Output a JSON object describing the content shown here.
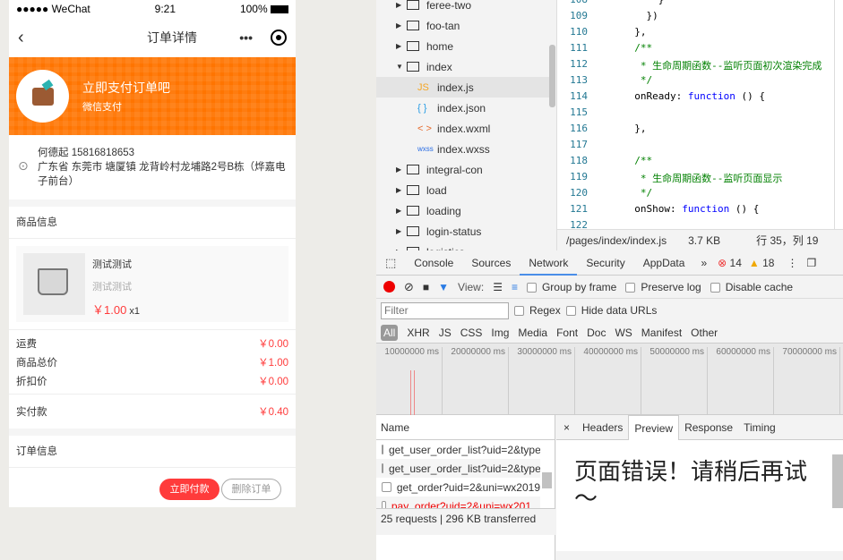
{
  "phone": {
    "status": {
      "carrier": "●●●●● WeChat",
      "time": "9:21",
      "battery": "100%"
    },
    "nav": {
      "title": "订单详情",
      "more": "•••"
    },
    "banner": {
      "title": "立即支付订单吧",
      "subtitle": "微信支付",
      "color": "#ff7400"
    },
    "address": {
      "contact": "何德起 15816818653",
      "line": "广东省 东莞市 塘厦镇 龙背岭村龙埔路2号B栋（烨嘉电子前台）"
    },
    "goods_header": "商品信息",
    "goods": {
      "name": "测试测试",
      "spec": "测试测试",
      "price": "￥1.00",
      "qty": "x1"
    },
    "fees": [
      {
        "label": "运费",
        "value": "￥0.00"
      },
      {
        "label": "商品总价",
        "value": "￥1.00"
      },
      {
        "label": "折扣价",
        "value": "￥0.00"
      }
    ],
    "paid": {
      "label": "实付款",
      "value": "￥0.40"
    },
    "order_header": "订单信息",
    "pay_button": "立即付款",
    "delete_button": "删除订单",
    "accent": "#ff3b3b"
  },
  "tree": [
    {
      "name": "feree-two",
      "type": "folder"
    },
    {
      "name": "foo-tan",
      "type": "folder"
    },
    {
      "name": "home",
      "type": "folder"
    },
    {
      "name": "index",
      "type": "folder-open"
    },
    {
      "name": "index.js",
      "icon": "JS",
      "selected": true
    },
    {
      "name": "index.json",
      "icon": "{ }"
    },
    {
      "name": "index.wxml",
      "icon": "< >"
    },
    {
      "name": "index.wxss",
      "icon": "wxss"
    },
    {
      "name": "integral-con",
      "type": "folder"
    },
    {
      "name": "load",
      "type": "folder"
    },
    {
      "name": "loading",
      "type": "folder"
    },
    {
      "name": "login-status",
      "type": "folder"
    },
    {
      "name": "logistics",
      "type": "folder"
    }
  ],
  "code": [
    {
      "n": "108",
      "t": "      }"
    },
    {
      "n": "109",
      "t": "    })"
    },
    {
      "n": "110",
      "t": "  },"
    },
    {
      "n": "111",
      "t": "  /**",
      "c": 1
    },
    {
      "n": "112",
      "t": "   * 生命周期函数--监听页面初次渲染完成",
      "c": 1
    },
    {
      "n": "113",
      "t": "   */",
      "c": 1
    },
    {
      "n": "114",
      "t": "  onReady: ",
      "k": "function",
      "r": " () {"
    },
    {
      "n": "115",
      "t": ""
    },
    {
      "n": "116",
      "t": "  },"
    },
    {
      "n": "117",
      "t": ""
    },
    {
      "n": "118",
      "t": "  /**",
      "c": 1
    },
    {
      "n": "119",
      "t": "   * 生命周期函数--监听页面显示",
      "c": 1
    },
    {
      "n": "120",
      "t": "   */",
      "c": 1
    },
    {
      "n": "121",
      "t": "  onShow: ",
      "k": "function",
      "r": " () {"
    },
    {
      "n": "122",
      "t": ""
    }
  ],
  "file_status": {
    "path": "/pages/index/index.js",
    "size": "3.7 KB",
    "cursor": "行 35，列 19"
  },
  "devtools": {
    "tabs": [
      "Console",
      "Sources",
      "Network",
      "Security",
      "AppData"
    ],
    "active_tab": "Network",
    "more": "»",
    "errors": "14",
    "warnings": "18",
    "toolbar": {
      "view_label": "View:",
      "group_by_frame": "Group by frame",
      "preserve_log": "Preserve log",
      "disable_cache": "Disable cache"
    },
    "filter_placeholder": "Filter",
    "regex": "Regex",
    "hide_data_urls": "Hide data URLs",
    "types": [
      "All",
      "XHR",
      "JS",
      "CSS",
      "Img",
      "Media",
      "Font",
      "Doc",
      "WS",
      "Manifest",
      "Other"
    ],
    "timeline_ticks": [
      "10000000 ms",
      "20000000 ms",
      "30000000 ms",
      "40000000 ms",
      "50000000 ms",
      "60000000 ms",
      "70000000 ms"
    ],
    "name_header": "Name",
    "requests": [
      {
        "name": "get_user_order_list?uid=2&type"
      },
      {
        "name": "get_user_order_list?uid=2&type"
      },
      {
        "name": "get_order?uid=2&uni=wx2019"
      },
      {
        "name": "pay_order?uid=2&uni=wx201...",
        "error": true
      },
      {
        "name": "pay_order?uid=2&uni=wx201...",
        "selected": true
      }
    ],
    "summary": "25 requests  |  296 KB transferred",
    "detail_tabs": [
      "Headers",
      "Preview",
      "Response",
      "Timing"
    ],
    "active_detail": "Preview",
    "preview_text": "页面错误！请稍后再试～"
  }
}
